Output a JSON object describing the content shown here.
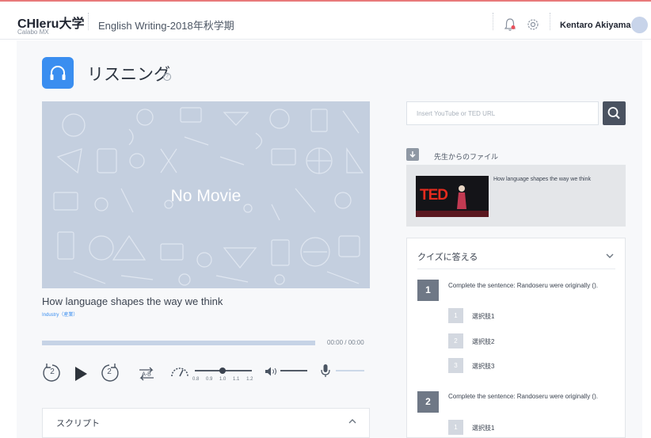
{
  "header": {
    "logo": "CHIeru大学",
    "logo_sub": "Calabo MX",
    "course": "English Writing-2018年秋学期",
    "user_name": "Kentaro Akiyama"
  },
  "page": {
    "title": "リスニング",
    "help": "?"
  },
  "player": {
    "no_movie": "No Movie",
    "video_title": "How language shapes the way we think",
    "video_tag": "Industry（産業）",
    "time": "00:00 / 00:00",
    "rewind_seconds": "2",
    "forward_seconds": "2",
    "speed_labels": [
      "0.8",
      "0.9",
      "1.0",
      "1.1",
      "1.2"
    ],
    "progress": 0.0
  },
  "script": {
    "title": "スクリプト"
  },
  "search": {
    "placeholder": "Insert YouTube or TED URL"
  },
  "files": {
    "label": "先生からのファイル",
    "item_title": "How language shapes the way we think",
    "thumb_text": "TED"
  },
  "quiz": {
    "title": "クイズに答える",
    "questions": [
      {
        "number": "1",
        "text": "Complete the sentence: Randoseru were originally ().",
        "options": [
          {
            "number": "1",
            "label": "選択肢1"
          },
          {
            "number": "2",
            "label": "選択肢2"
          },
          {
            "number": "3",
            "label": "選択肢3"
          }
        ]
      },
      {
        "number": "2",
        "text": "Complete the sentence: Randoseru were originally ().",
        "options": [
          {
            "number": "1",
            "label": "選択肢1"
          }
        ]
      }
    ]
  },
  "colors": {
    "accent": "#3a8ef0",
    "top_line": "#e8797a",
    "dark_button": "#4a5260",
    "video_bg": "#c4cfdf"
  },
  "icons": [
    "headphones-icon",
    "help-icon",
    "bell-icon",
    "gear-icon",
    "search-icon",
    "download-folder-icon",
    "chevron-up-icon",
    "chevron-down-icon",
    "play-icon",
    "rewind-icon",
    "forward-icon",
    "ab-repeat-icon",
    "speed-icon",
    "volume-icon",
    "mic-icon"
  ]
}
